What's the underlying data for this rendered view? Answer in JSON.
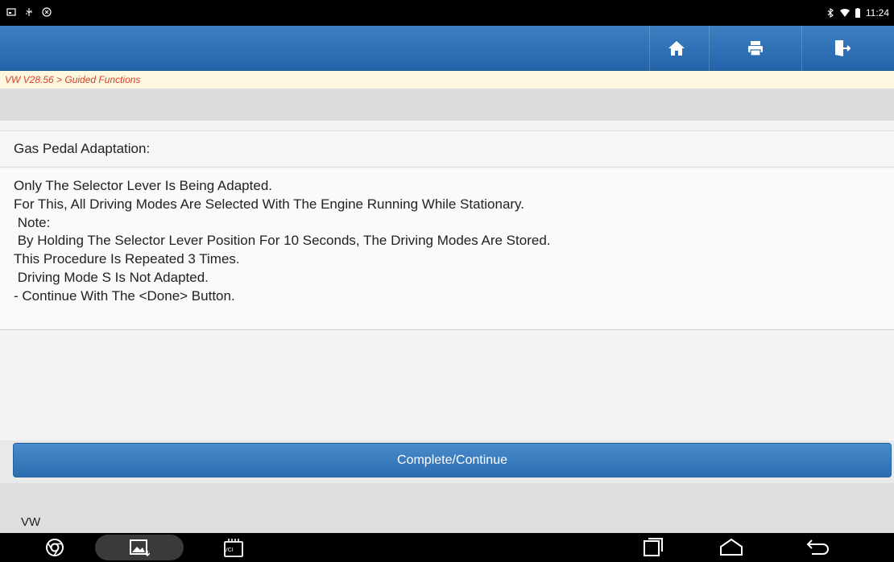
{
  "status_bar": {
    "time": "11:24",
    "left_icons": [
      "screenshot-icon",
      "usb-icon",
      "cast-icon"
    ],
    "right_icons": [
      "bluetooth-icon",
      "wifi-icon",
      "battery-icon"
    ]
  },
  "toolbar": {
    "buttons": [
      "home-icon",
      "print-icon",
      "exit-icon"
    ],
    "accent": "#2e6fb5"
  },
  "breadcrumb": "VW V28.56 > Guided Functions",
  "section_title": "Gas Pedal Adaptation:",
  "message_lines": [
    "Only The Selector Lever Is Being Adapted.",
    "For This, All Driving Modes Are Selected With The Engine Running While Stationary.",
    " Note:",
    " By Holding The Selector Lever Position For 10 Seconds, The Driving Modes Are Stored.",
    "This Procedure Is Repeated 3 Times.",
    " Driving Mode S Is Not Adapted.",
    "- Continue With The <Done> Button."
  ],
  "complete_button": "Complete/Continue",
  "footer_label": "VW",
  "nav_bar": {
    "left": [
      "chrome-icon",
      "gallery-icon",
      "vci-icon"
    ],
    "right": [
      "recent-apps-icon",
      "home-nav-icon",
      "back-icon"
    ],
    "vci_label": "VCI"
  }
}
